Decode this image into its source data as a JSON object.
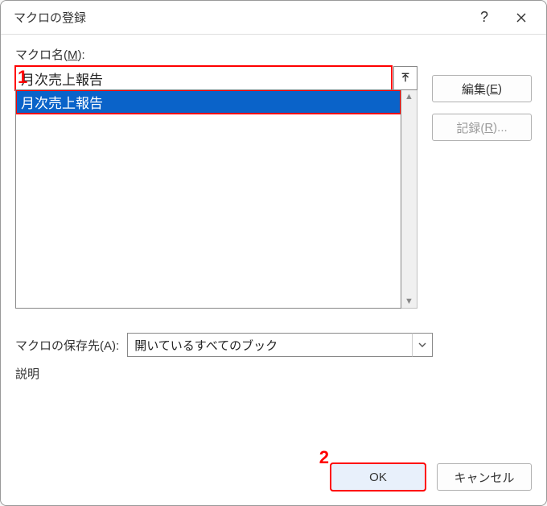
{
  "titlebar": {
    "title": "マクロの登録"
  },
  "labels": {
    "macro_name": "マクロ名(",
    "macro_name_u": "M",
    "macro_name_suffix": "):",
    "storage": "マクロの保存先(",
    "storage_u": "A",
    "storage_suffix": "):",
    "description": "説明"
  },
  "input": {
    "value": "月次売上報告"
  },
  "list": {
    "items": [
      "月次売上報告"
    ]
  },
  "storage_select": {
    "value": "開いているすべてのブック"
  },
  "buttons": {
    "edit_prefix": "編集(",
    "edit_u": "E",
    "edit_suffix": ")",
    "record_prefix": "記録(",
    "record_u": "R",
    "record_suffix": ")...",
    "ok": "OK",
    "cancel": "キャンセル"
  },
  "markers": {
    "m1": "1",
    "m2": "2"
  }
}
